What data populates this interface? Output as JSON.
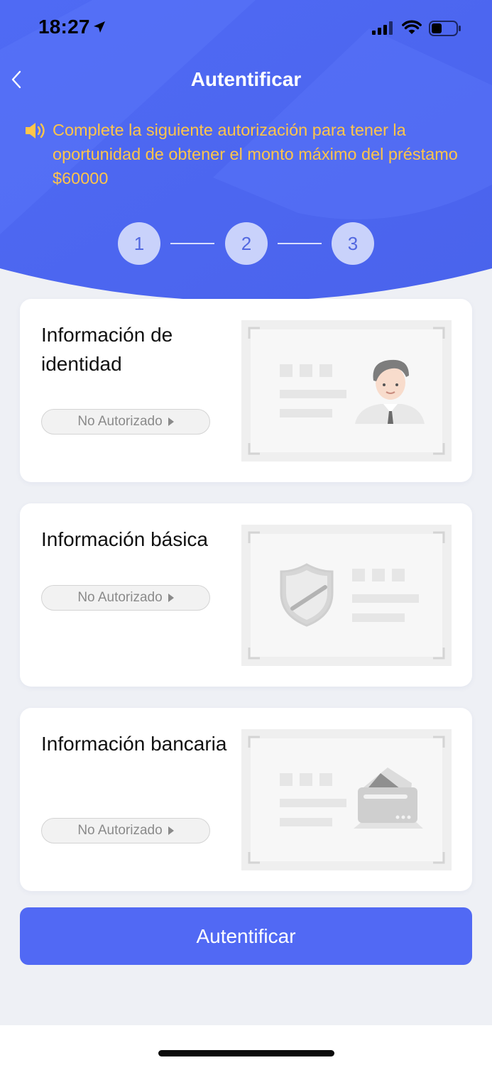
{
  "status_bar": {
    "time": "18:27",
    "icons": [
      "location-arrow-icon",
      "cellular-signal-icon",
      "wifi-icon",
      "battery-icon"
    ]
  },
  "header": {
    "title": "Autentificar",
    "back_icon": "chevron-left-icon"
  },
  "notice": {
    "icon": "speaker-icon",
    "text": "Complete la siguiente autorización para tener la oportunidad de obtener el monto máximo del préstamo $60000"
  },
  "steps": [
    "1",
    "2",
    "3"
  ],
  "cards": [
    {
      "title": "Información de identidad",
      "status": "No Autorizado",
      "illustration": "identity-card-icon"
    },
    {
      "title": "Información básica",
      "status": "No Autorizado",
      "illustration": "shield-icon"
    },
    {
      "title": "Información bancaria",
      "status": "No Autorizado",
      "illustration": "bank-card-icon"
    }
  ],
  "cta": {
    "label": "Autentificar"
  },
  "colors": {
    "hero_blue": "#4e67ee",
    "accent_yellow": "#ffc54a",
    "button_blue": "#5169f4",
    "page_bg": "#eef0f5"
  }
}
